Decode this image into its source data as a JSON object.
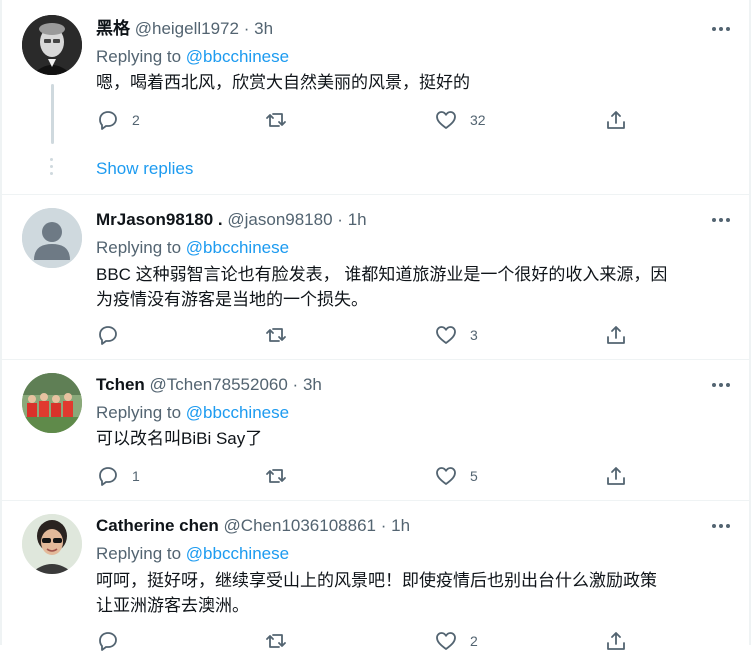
{
  "tweets": [
    {
      "name": "黑格",
      "handle": "@heigell1972",
      "dot": "·",
      "time": "3h",
      "replying_label": "Replying to",
      "replying_to": "@bbcchinese",
      "text_lines": [
        "嗯，喝着西北风，欣赏大自然美丽的风景，挺好的"
      ],
      "reply_count": "2",
      "retweet_count": "",
      "like_count": "32",
      "avatar_icon": "bw-portrait-photo"
    },
    {
      "name": "MrJason98180 .",
      "handle": "@jason98180",
      "dot": "·",
      "time": "1h",
      "replying_label": "Replying to",
      "replying_to": "@bbcchinese",
      "text_lines": [
        "BBC 这种弱智言论也有脸发表， 谁都知道旅游业是一个很好的收入来源，因",
        "为疫情没有游客是当地的一个损失。"
      ],
      "reply_count": "",
      "retweet_count": "",
      "like_count": "3",
      "avatar_icon": "default-user-avatar"
    },
    {
      "name": "Tchen",
      "handle": "@Tchen78552060",
      "dot": "·",
      "time": "3h",
      "replying_label": "Replying to",
      "replying_to": "@bbcchinese",
      "text_lines": [
        "可以改名叫BiBi Say了"
      ],
      "reply_count": "1",
      "retweet_count": "",
      "like_count": "5",
      "avatar_icon": "team-photo"
    },
    {
      "name": "Catherine chen",
      "handle": "@Chen1036108861",
      "dot": "·",
      "time": "1h",
      "replying_label": "Replying to",
      "replying_to": "@bbcchinese",
      "text_lines": [
        "呵呵，挺好呀，继续享受山上的风景吧！即使疫情后也别出台什么激励政策",
        "让亚洲游客去澳洲。"
      ],
      "reply_count": "",
      "retweet_count": "",
      "like_count": "2",
      "avatar_icon": "woman-sunglasses-photo"
    }
  ],
  "show_replies_label": "Show replies",
  "colors": {
    "link": "#1d9bf0",
    "muted": "#536471",
    "text": "#0f1419",
    "border": "#eff3f4"
  }
}
